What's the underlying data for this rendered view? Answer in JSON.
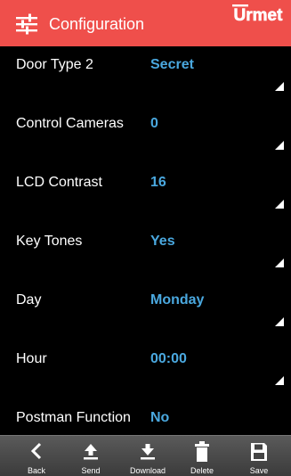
{
  "header": {
    "title": "Configuration",
    "brand": "URMET",
    "icon": "sliders-icon",
    "background_color": "#ef4f4b"
  },
  "settings": [
    {
      "label": "Door Type 2",
      "value": "Secret"
    },
    {
      "label": "Control Cameras",
      "value": "0"
    },
    {
      "label": "LCD Contrast",
      "value": "16"
    },
    {
      "label": "Key Tones",
      "value": "Yes"
    },
    {
      "label": "Day",
      "value": "Monday"
    },
    {
      "label": "Hour",
      "value": "00:00"
    },
    {
      "label": "Postman Function",
      "value": "No"
    }
  ],
  "value_color": "#4aa8df",
  "toolbar": {
    "back_label": "Back",
    "send_label": "Send",
    "download_label": "Download",
    "delete_label": "Delete",
    "save_label": "Save"
  }
}
